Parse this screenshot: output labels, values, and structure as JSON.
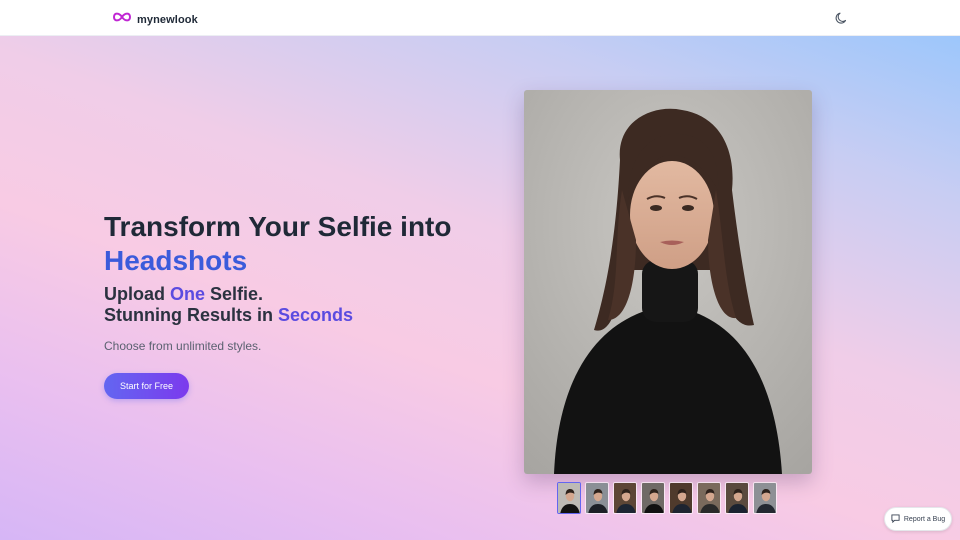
{
  "brand": {
    "name": "mynewlook",
    "logo_icon": "infinity-icon",
    "logo_color": "#c026d3"
  },
  "header": {
    "theme_toggle_icon": "moon-icon"
  },
  "hero": {
    "title_line1": "Transform Your Selfie into",
    "title_accent": "Headshots",
    "subtitle_part1": "Upload ",
    "subtitle_accent1": "One",
    "subtitle_part2": " Selfie.",
    "subtitle_part3": "Stunning Results in ",
    "subtitle_accent2": "Seconds",
    "tagline": "Choose from unlimited styles.",
    "cta_label": "Start for Free"
  },
  "gallery": {
    "main_image": "headshot-woman-black-turtleneck",
    "thumbnails": [
      {
        "name": "headshot-woman-black-turtleneck",
        "active": true
      },
      {
        "name": "headshot-woman-suit",
        "active": false
      },
      {
        "name": "headshot-man-suit-bookshelf",
        "active": false
      },
      {
        "name": "headshot-man-turtleneck",
        "active": false
      },
      {
        "name": "headshot-man-suit-library",
        "active": false
      },
      {
        "name": "headshot-woman-blazer",
        "active": false
      },
      {
        "name": "headshot-man-suit-office",
        "active": false
      },
      {
        "name": "headshot-man-suit-grey",
        "active": false
      }
    ]
  },
  "report_bug": {
    "label": "Report a Bug",
    "icon": "message-bug-icon"
  },
  "colors": {
    "accent_blue": "#3b5bdb",
    "accent_purple": "#5b4be0",
    "cta_start": "#6366f1",
    "cta_end": "#7c3aed"
  }
}
